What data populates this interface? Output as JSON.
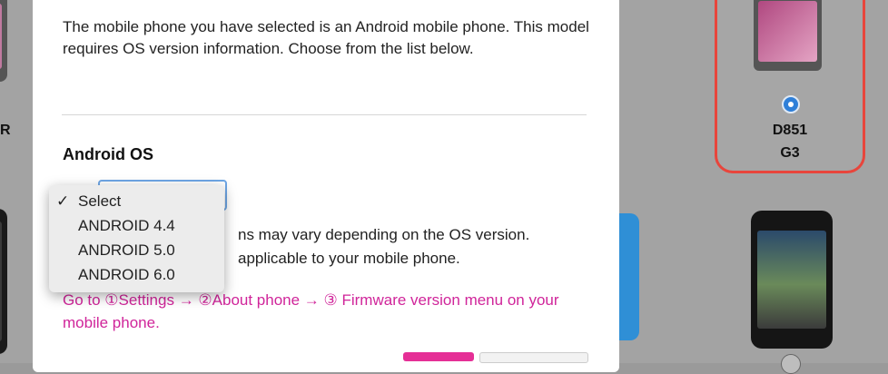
{
  "modal": {
    "intro": "The mobile phone you have selected is an Android mobile phone. This model requires OS version information. Choose from the list below.",
    "os_heading": "Android OS",
    "note_line1": "ns may vary depending on the OS version.",
    "note_line2": "applicable to your mobile phone.",
    "instructions": "Go to ①Settings → ②About phone → ③ Firmware version menu on your mobile phone."
  },
  "dropdown": {
    "options": [
      {
        "label": "Select",
        "selected": true,
        "check": "✓"
      },
      {
        "label": "ANDROID 4.4",
        "selected": false,
        "check": ""
      },
      {
        "label": "ANDROID 5.0",
        "selected": false,
        "check": ""
      },
      {
        "label": "ANDROID 6.0",
        "selected": false,
        "check": ""
      }
    ]
  },
  "background": {
    "edge_label": "R",
    "selected_phone": {
      "model": "D851",
      "name": "G3"
    }
  },
  "colors": {
    "accent_pink": "#d0259a",
    "selected_border": "#e8453c",
    "radio_blue": "#2f7fd8",
    "focus_blue": "#6fa7e6"
  }
}
